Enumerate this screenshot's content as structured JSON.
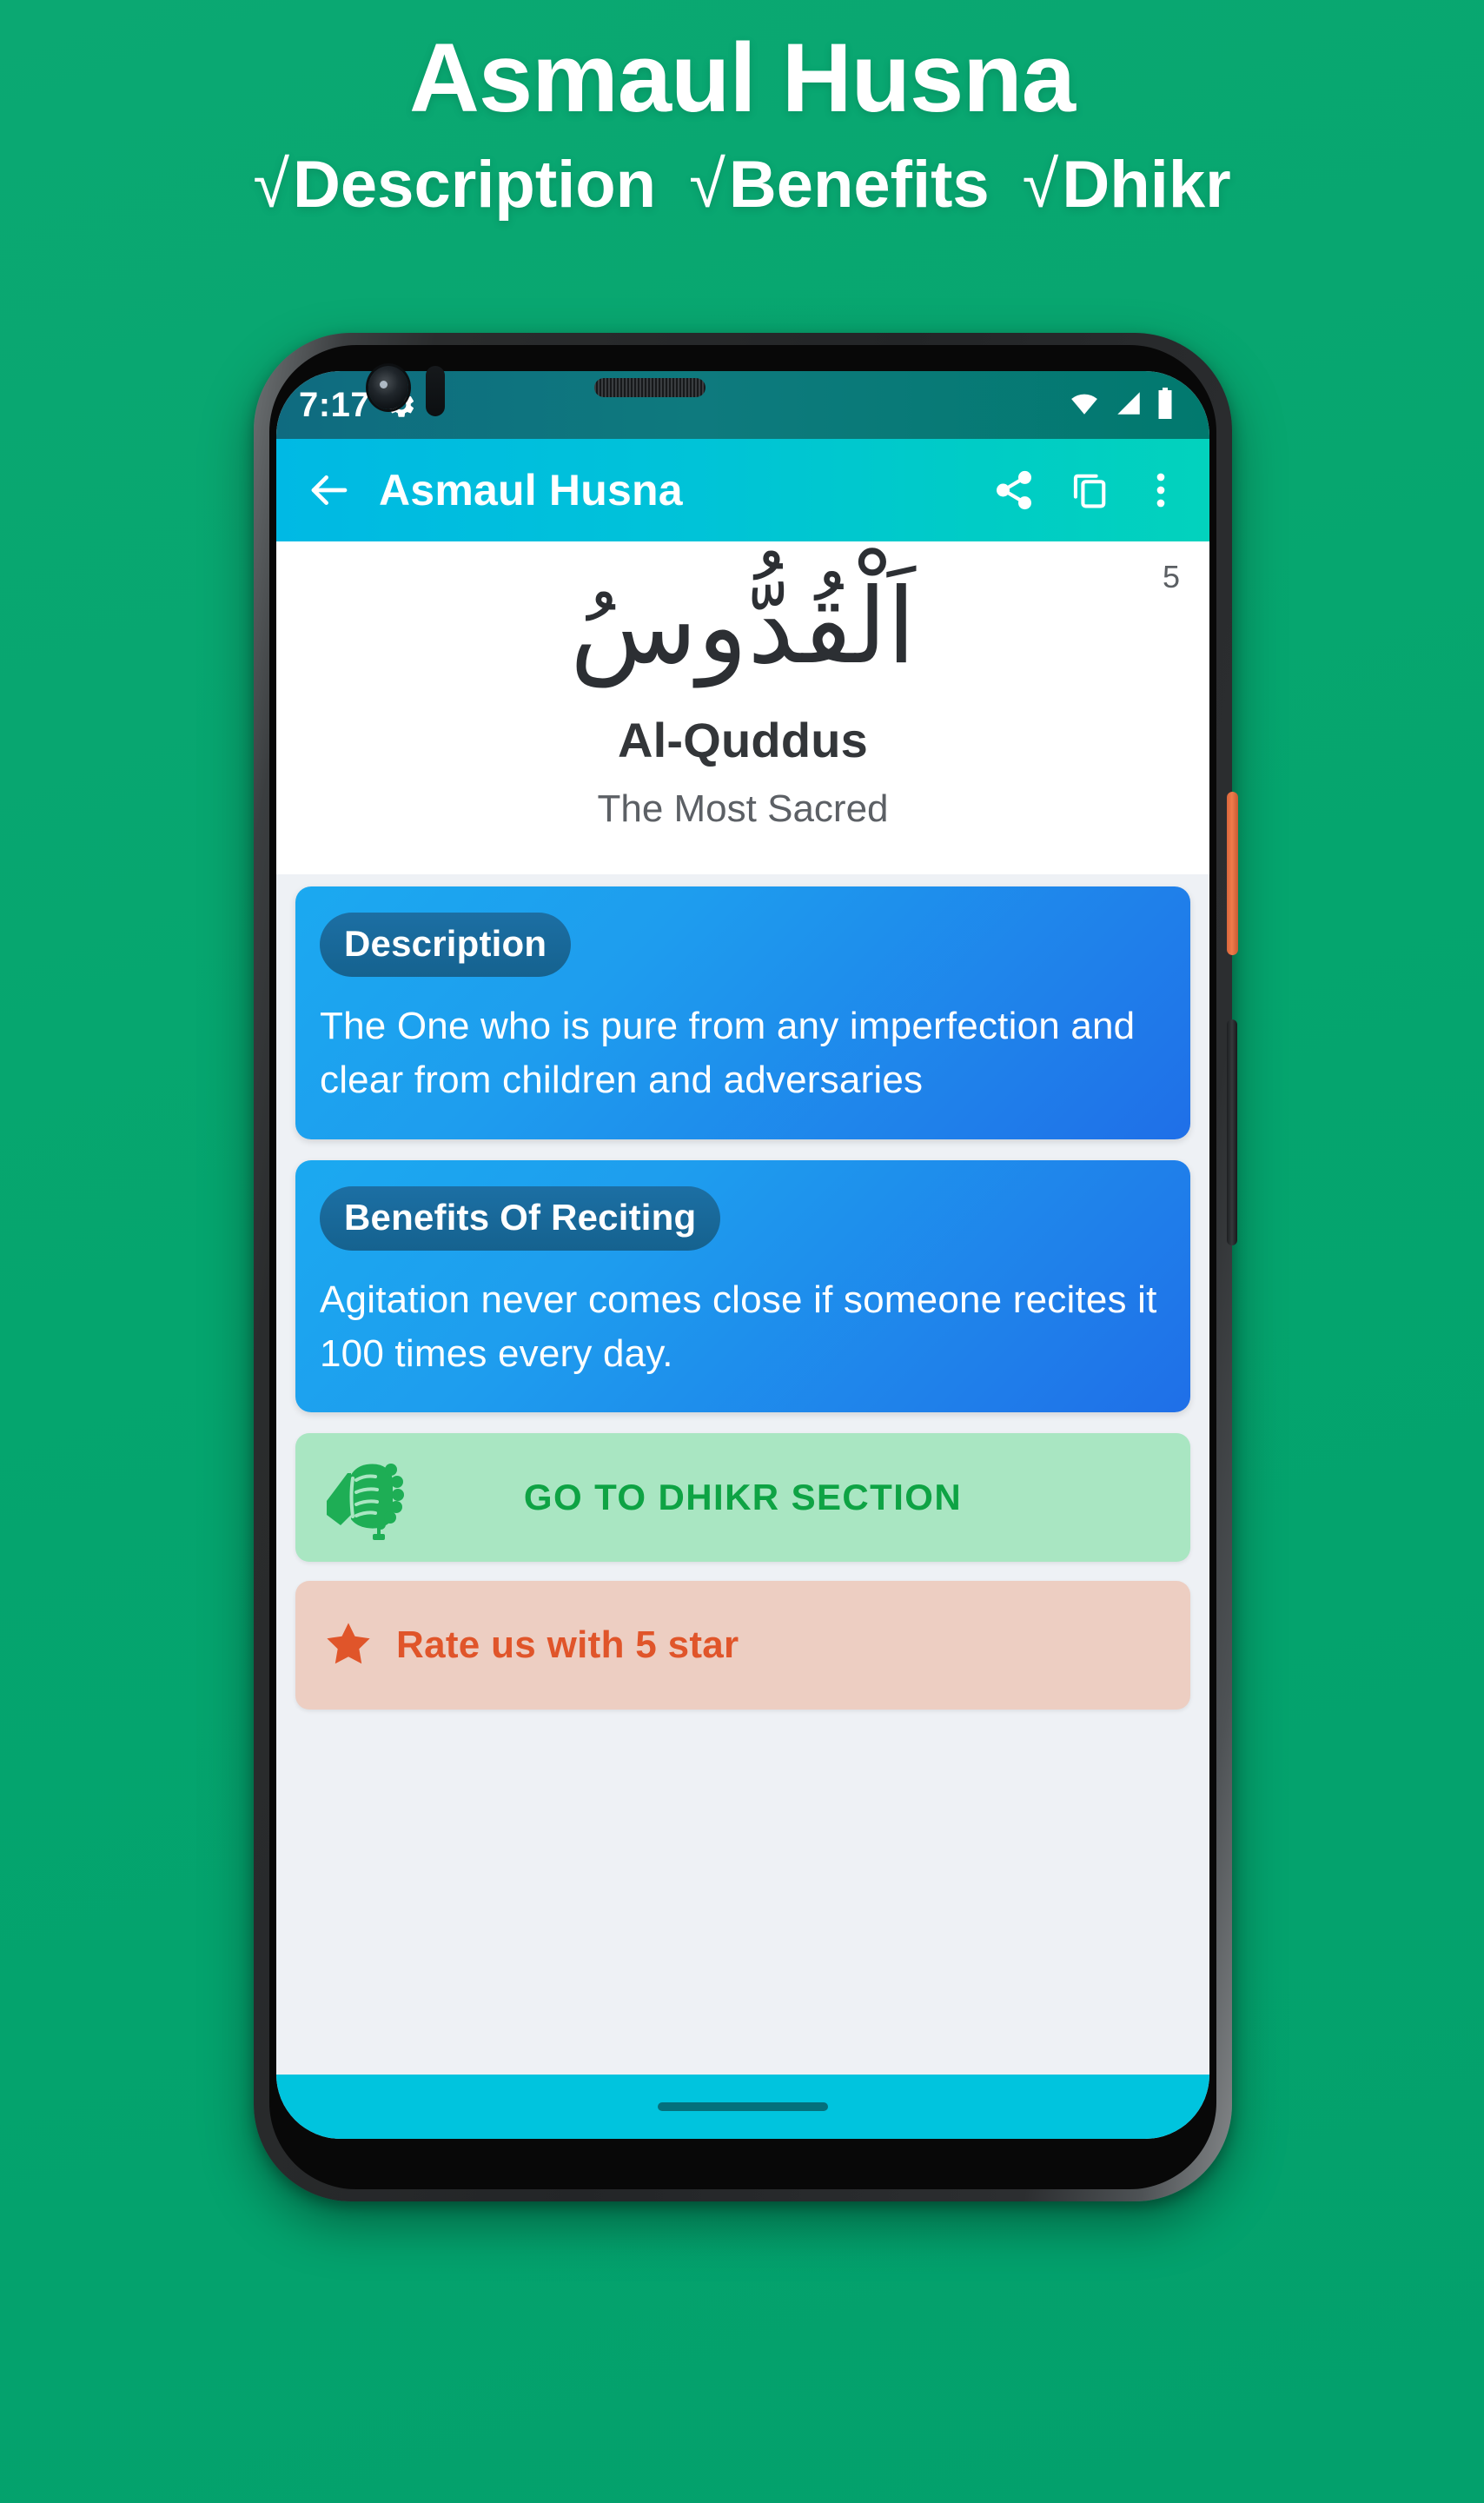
{
  "promo": {
    "title": "Asmaul Husna",
    "features": [
      {
        "check": "√",
        "label": "Description"
      },
      {
        "check": "√",
        "label": "Benefits"
      },
      {
        "check": "√",
        "label": "Dhikr"
      }
    ]
  },
  "phone": {
    "statusbar": {
      "time": "7:17",
      "gear_icon": "gear-icon",
      "wifi_icon": "wifi-icon",
      "signal_icon": "signal-icon",
      "battery_icon": "battery-icon"
    },
    "appbar": {
      "back_icon": "back-arrow-icon",
      "title": "Asmaul Husna",
      "share_icon": "share-icon",
      "copy_icon": "copy-icon",
      "menu_icon": "overflow-menu-icon"
    },
    "name": {
      "index": "5",
      "arabic": "اَلْقُدُّوسُ",
      "latin": "Al-Quddus",
      "meaning": "The Most Sacred"
    },
    "cards": [
      {
        "chip": "Description",
        "text": "The One who is pure from any imperfection and clear from children and adversaries"
      },
      {
        "chip": "Benefits Of Reciting",
        "text": "Agitation never comes close if someone recites it 100 times every day."
      }
    ],
    "buttons": {
      "dhikr": {
        "label": "GO TO DHIKR SECTION",
        "icon": "tasbih-hand-icon"
      },
      "rate": {
        "label": "Rate us with 5 star",
        "icon": "star-icon"
      }
    },
    "navbar": {
      "gesture_pill": "home-gesture-pill"
    }
  },
  "colors": {
    "background_green": "#05A56E",
    "appbar_cyan": "#00B9E4",
    "appbar_teal": "#02D2BD",
    "card_blue_light": "#1BA9F0",
    "card_blue_dark": "#1F6FE8",
    "chip_blue": "#1C6FA4",
    "dhikr_bg": "#A9E6C2",
    "dhikr_text": "#0EA344",
    "rate_bg": "#EDCEC2",
    "rate_text": "#E0552A",
    "navbar_cyan": "#00C4DE"
  }
}
